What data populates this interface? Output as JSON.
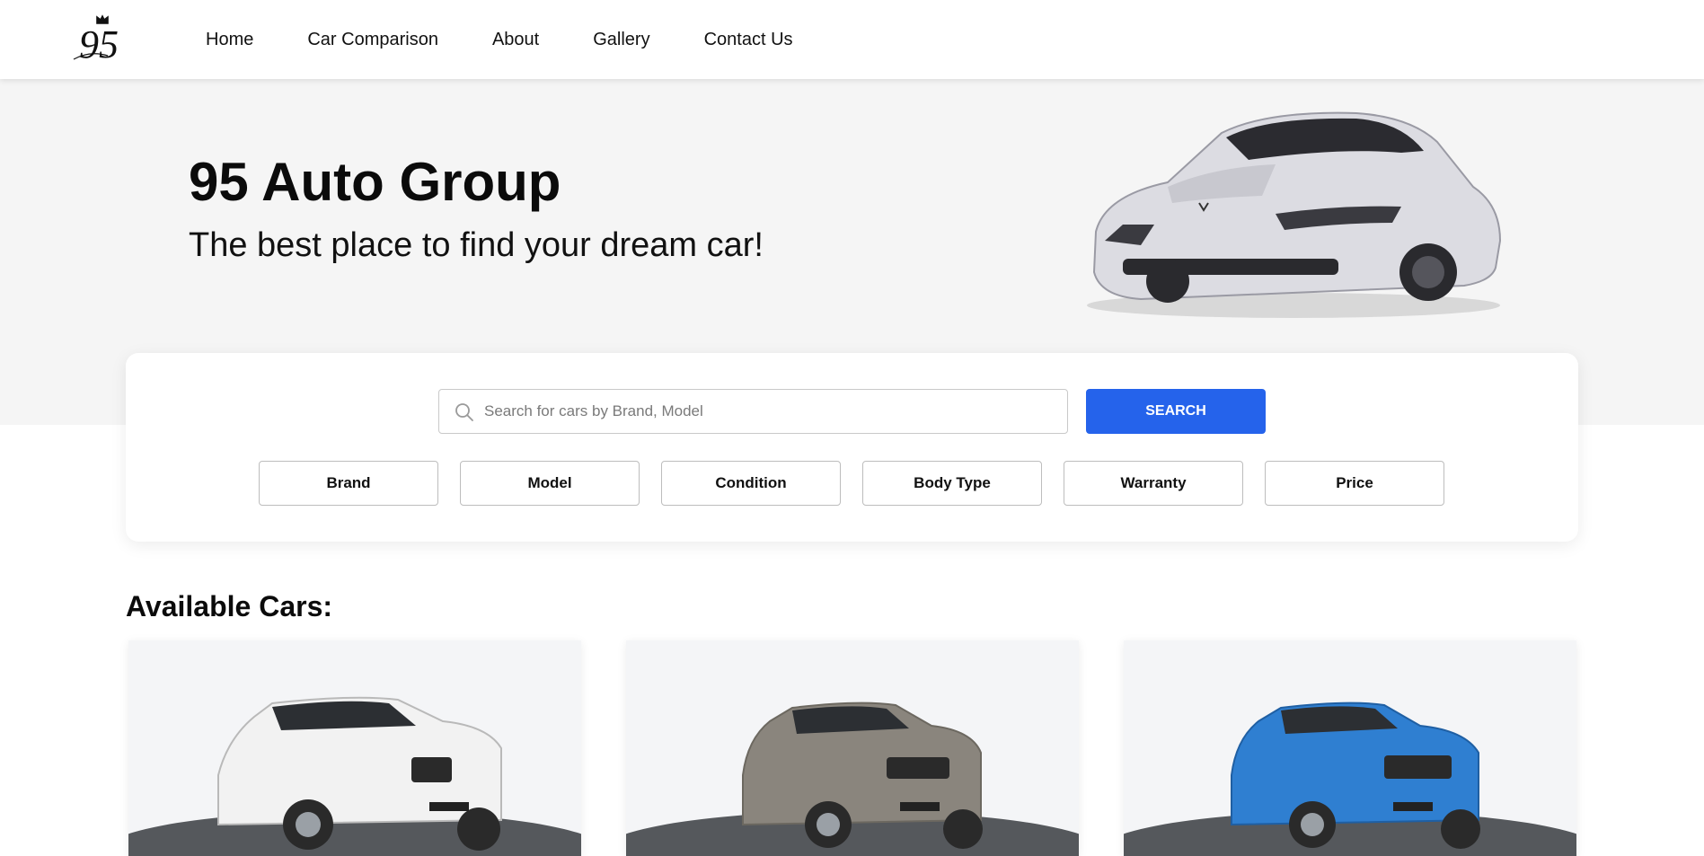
{
  "brand": {
    "logo_text": "95",
    "logo_icon": "crown-icon"
  },
  "nav": {
    "items": [
      {
        "label": "Home"
      },
      {
        "label": "Car Comparison"
      },
      {
        "label": "About"
      },
      {
        "label": "Gallery"
      },
      {
        "label": "Contact Us"
      }
    ]
  },
  "hero": {
    "title": "95 Auto Group",
    "subtitle": "The best place to find your dream car!"
  },
  "search": {
    "placeholder": "Search for cars by Brand, Model",
    "value": "",
    "button_label": "SEARCH",
    "icon": "search-icon"
  },
  "filters": [
    {
      "label": "Brand"
    },
    {
      "label": "Model"
    },
    {
      "label": "Condition"
    },
    {
      "label": "Body Type"
    },
    {
      "label": "Warranty"
    },
    {
      "label": "Price"
    }
  ],
  "listing": {
    "title": "Available Cars:",
    "cars": [
      {
        "color": "#f2f2f2"
      },
      {
        "color": "#8a857d"
      },
      {
        "color": "#2f7fd1"
      }
    ]
  },
  "colors": {
    "accent": "#2563eb",
    "hero_bg": "#f5f5f5"
  }
}
